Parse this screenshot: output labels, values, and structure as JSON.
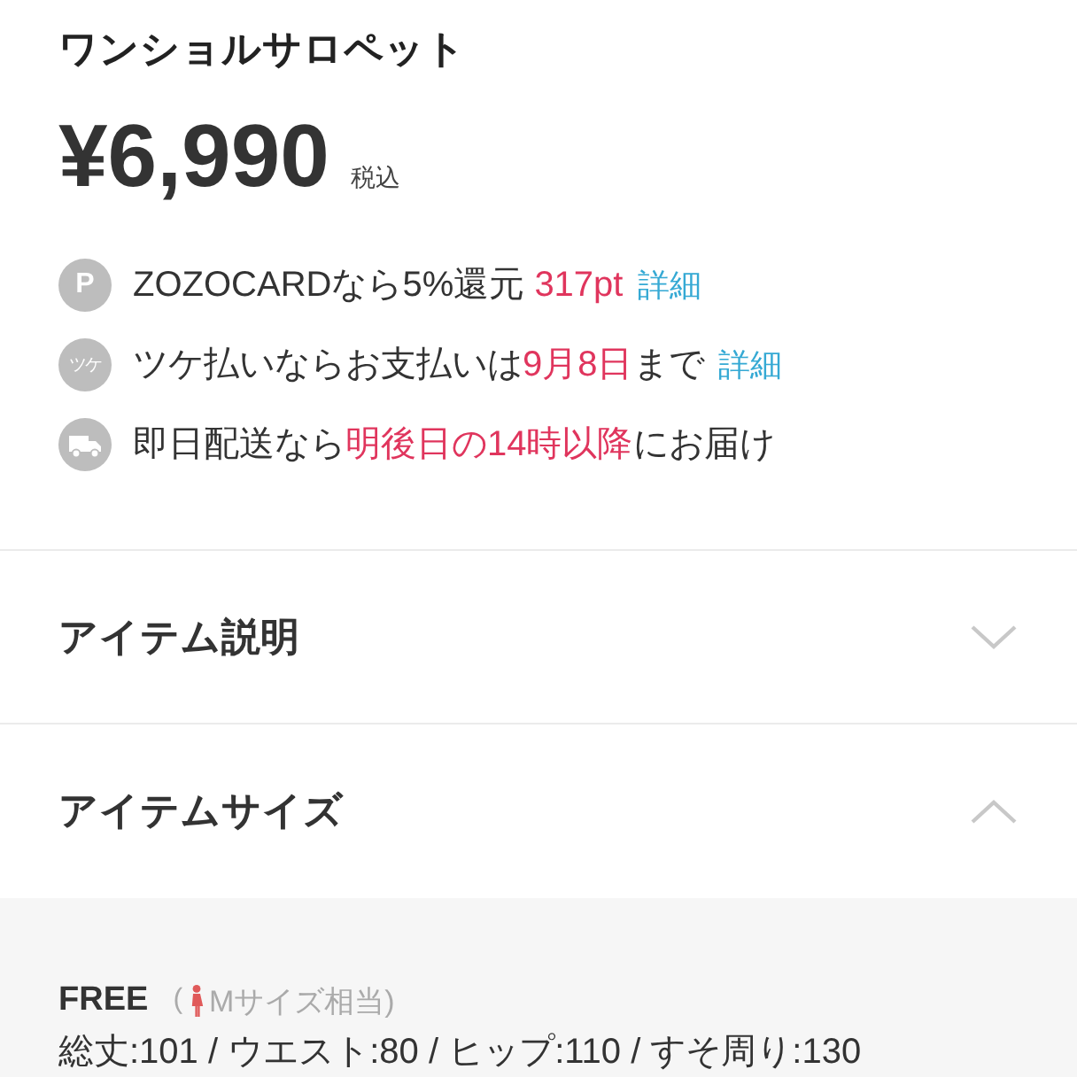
{
  "product": {
    "title": "ワンショルサロペット",
    "price": "¥6,990",
    "tax_note": "税込"
  },
  "benefits": [
    {
      "kind": "points",
      "badge": "P",
      "segments": [
        {
          "text": "ZOZOCARDなら5%還元 ",
          "highlight": false
        },
        {
          "text": "317pt",
          "highlight": true
        }
      ],
      "link": "詳細"
    },
    {
      "kind": "deferred",
      "badge": "ツケ",
      "segments": [
        {
          "text": "ツケ払いならお支払いは",
          "highlight": false
        },
        {
          "text": "9月8日",
          "highlight": true
        },
        {
          "text": "まで",
          "highlight": false
        }
      ],
      "link": "詳細"
    },
    {
      "kind": "delivery",
      "segments": [
        {
          "text": "即日配送なら",
          "highlight": false
        },
        {
          "text": "明後日の14時以降",
          "highlight": true
        },
        {
          "text": "にお届け",
          "highlight": false
        }
      ]
    }
  ],
  "sections": [
    {
      "title": "アイテム説明",
      "expanded": false
    },
    {
      "title": "アイテムサイズ",
      "expanded": true,
      "content": {
        "size": "FREE",
        "note_open": "(",
        "note": "Mサイズ相当)",
        "measurements": "総丈:101 / ウエスト:80 / ヒップ:110 / すそ周り:130"
      }
    }
  ]
}
